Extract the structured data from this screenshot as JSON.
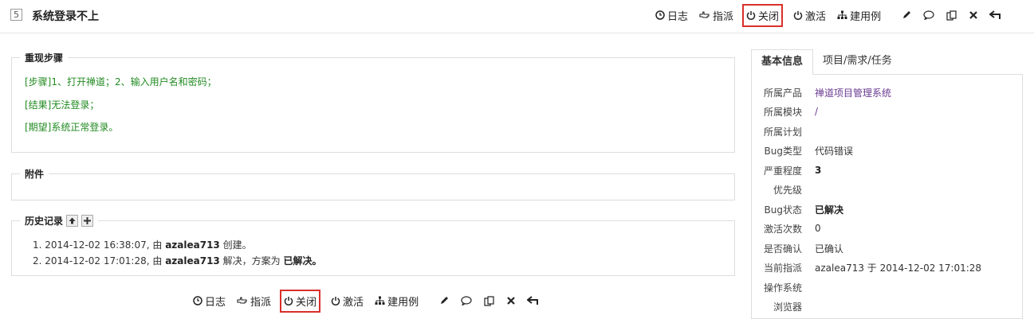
{
  "header": {
    "bug_id": "5",
    "title": "系统登录不上"
  },
  "actions": {
    "log": "日志",
    "assign": "指派",
    "close": "关闭",
    "activate": "激活",
    "create_case": "建用例"
  },
  "steps": {
    "legend": "重现步骤",
    "lines": [
      "[步骤]1、打开禅道；2、输入用户名和密码；",
      "[结果]无法登录；",
      "[期望]系统正常登录。"
    ]
  },
  "files": {
    "legend": "附件"
  },
  "history": {
    "legend": "历史记录",
    "entries": [
      {
        "num": "1.",
        "time": "2014-12-02 16:38:07, 由",
        "user": "azalea713",
        "action": "创建。",
        "extra_label": "",
        "extra_value": ""
      },
      {
        "num": "2.",
        "time": "2014-12-02 17:01:28, 由",
        "user": "azalea713",
        "action": "解决，方案为",
        "extra_label": "",
        "extra_value": "已解决。"
      }
    ]
  },
  "sidebar": {
    "tabs": [
      "基本信息",
      "项目/需求/任务"
    ],
    "fields": [
      {
        "label": "所属产品",
        "value": "禅道项目管理系统"
      },
      {
        "label": "所属模块",
        "value": "/"
      },
      {
        "label": "所属计划",
        "value": ""
      },
      {
        "label": "Bug类型",
        "value": "代码错误"
      },
      {
        "label": "严重程度",
        "value": "3"
      },
      {
        "label": "优先级",
        "value": ""
      },
      {
        "label": "Bug状态",
        "value": "已解决"
      },
      {
        "label": "激活次数",
        "value": "0"
      },
      {
        "label": "是否确认",
        "value": "已确认"
      },
      {
        "label": "当前指派",
        "value": "azalea713 于 2014-12-02 17:01:28"
      },
      {
        "label": "操作系统",
        "value": ""
      },
      {
        "label": "浏览器",
        "value": ""
      }
    ]
  },
  "colors": {
    "highlight": "#d9302a",
    "steps_text": "#228b22",
    "link": "#6a3b91"
  }
}
